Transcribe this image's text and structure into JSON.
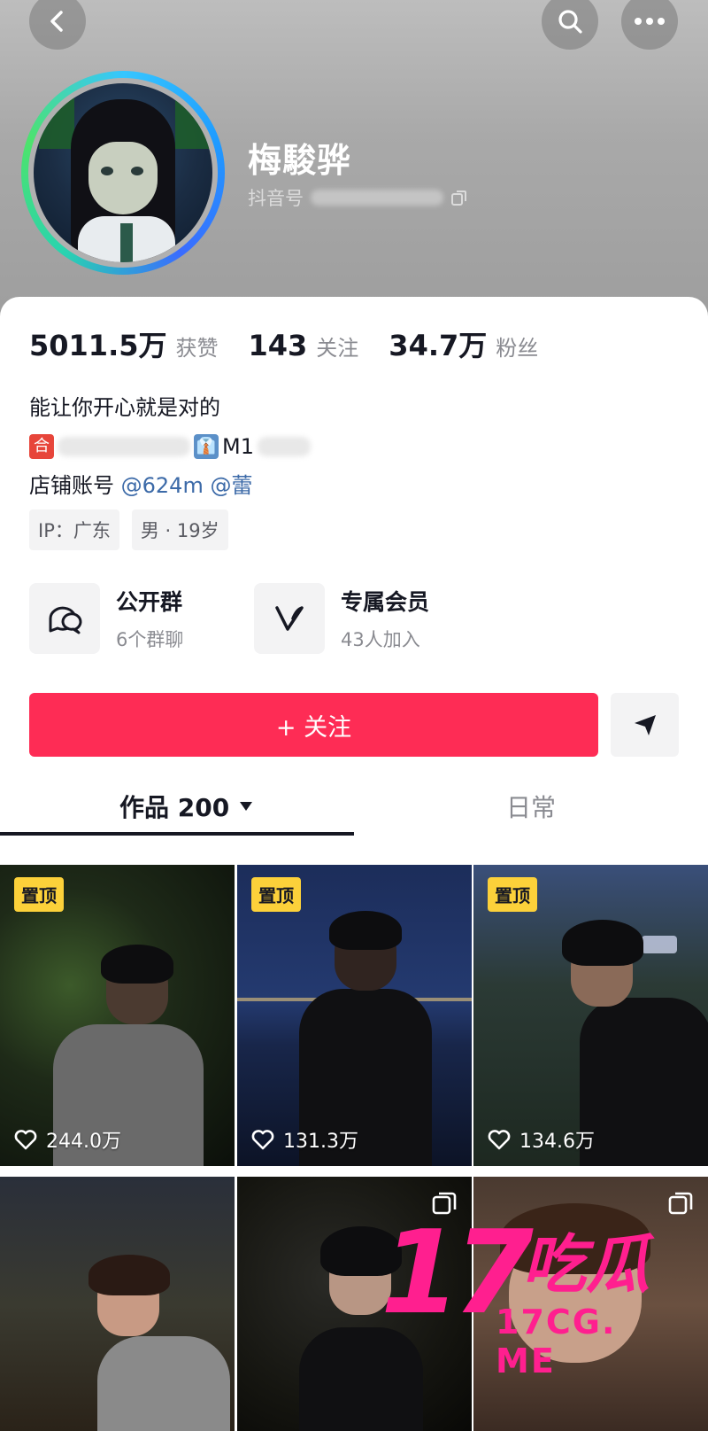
{
  "profile": {
    "name": "梅駿骅",
    "douyin_id_label": "抖音号",
    "stats": [
      {
        "num": "5011.5万",
        "label": "获赞"
      },
      {
        "num": "143",
        "label": "关注"
      },
      {
        "num": "34.7万",
        "label": "粉丝"
      }
    ],
    "bio_line1": "能让你开心就是对的",
    "bio_line2_tail": "M1",
    "bio_line3_prefix": "店铺账号",
    "mention1": "@624m",
    "mention2": "@蕾",
    "tags": [
      "IP：广东",
      "男 · 19岁"
    ]
  },
  "features": [
    {
      "title": "公开群",
      "subtitle": "6个群聊",
      "icon": "chat-group-icon"
    },
    {
      "title": "专属会员",
      "subtitle": "43人加入",
      "icon": "vip-icon"
    }
  ],
  "actions": {
    "follow_label": "+ 关注"
  },
  "tabs": {
    "works_label": "作品 200",
    "daily_label": "日常"
  },
  "posts": [
    {
      "pinned": true,
      "pin_label": "置顶",
      "likes": "244.0万"
    },
    {
      "pinned": true,
      "pin_label": "置顶",
      "likes": "131.3万"
    },
    {
      "pinned": true,
      "pin_label": "置顶",
      "likes": "134.6万"
    },
    {
      "pinned": false
    },
    {
      "pinned": false,
      "multi": true
    },
    {
      "pinned": false,
      "multi": true
    }
  ],
  "watermark": {
    "num": "17",
    "cn": "吃瓜",
    "site": "17CG. ME"
  },
  "colors": {
    "accent": "#fe2c55",
    "pin": "#fcd13a",
    "mention": "#3c6aa8",
    "watermark": "#ff1f8f"
  }
}
